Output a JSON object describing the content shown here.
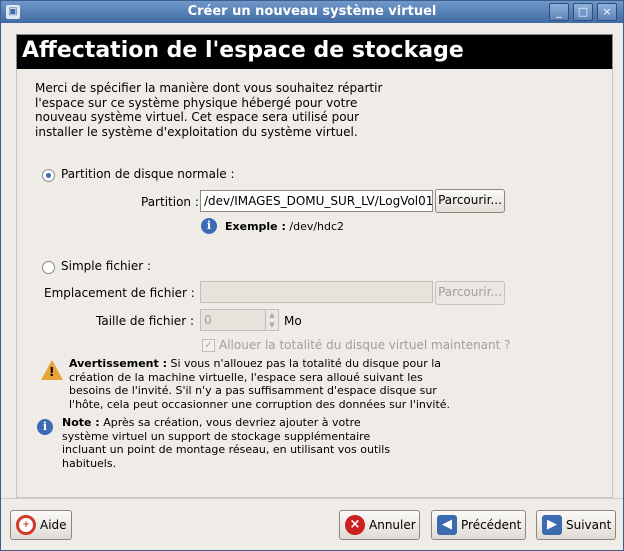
{
  "window": {
    "title": "Créer un nouveau système virtuel",
    "minimize_glyph": "_",
    "maximize_glyph": "□",
    "close_glyph": "×"
  },
  "page": {
    "heading": "Affectation de l'espace de stockage",
    "intro": "Merci de spécifier la manière dont vous souhaitez répartir l'espace sur ce système physique hébergé pour votre nouveau système virtuel. Cet espace sera utilisé pour installer le système d'exploitation du système virtuel."
  },
  "partition_option": {
    "radio_label": "Partition de disque normale :",
    "selected": true,
    "partition_label": "Partition :",
    "partition_value": "/dev/IMAGES_DOMU_SUR_LV/LogVol01",
    "browse_label": "Parcourir...",
    "example_bold": "Exemple :",
    "example_value": "/dev/hdc2"
  },
  "file_option": {
    "radio_label": "Simple fichier :",
    "selected": false,
    "location_label": "Emplacement de fichier :",
    "location_value": "",
    "browse_label": "Parcourir...",
    "size_label": "Taille de fichier :",
    "size_value": "0",
    "size_unit": "Mo",
    "allocate_label": "Allouer la totalité du disque virtuel maintenant ?",
    "allocate_checked": true
  },
  "warning": {
    "bold": "Avertissement :",
    "text": "Si vous n'allouez pas la totalité du disque pour la création de la machine virtuelle, l'espace sera alloué suivant les besoins de l'invité. S'il n'y a pas suffisamment d'espace disque sur l'hôte, cela peut occasionner une corruption des données sur l'invité."
  },
  "note": {
    "bold": "Note :",
    "text": "Après sa création, vous devriez ajouter à votre système virtuel un support de stockage supplémentaire incluant un point de montage réseau, en utilisant vos outils habituels."
  },
  "footer": {
    "help_label": "Aide",
    "cancel_label": "Annuler",
    "back_label": "Précédent",
    "next_label": "Suivant"
  }
}
